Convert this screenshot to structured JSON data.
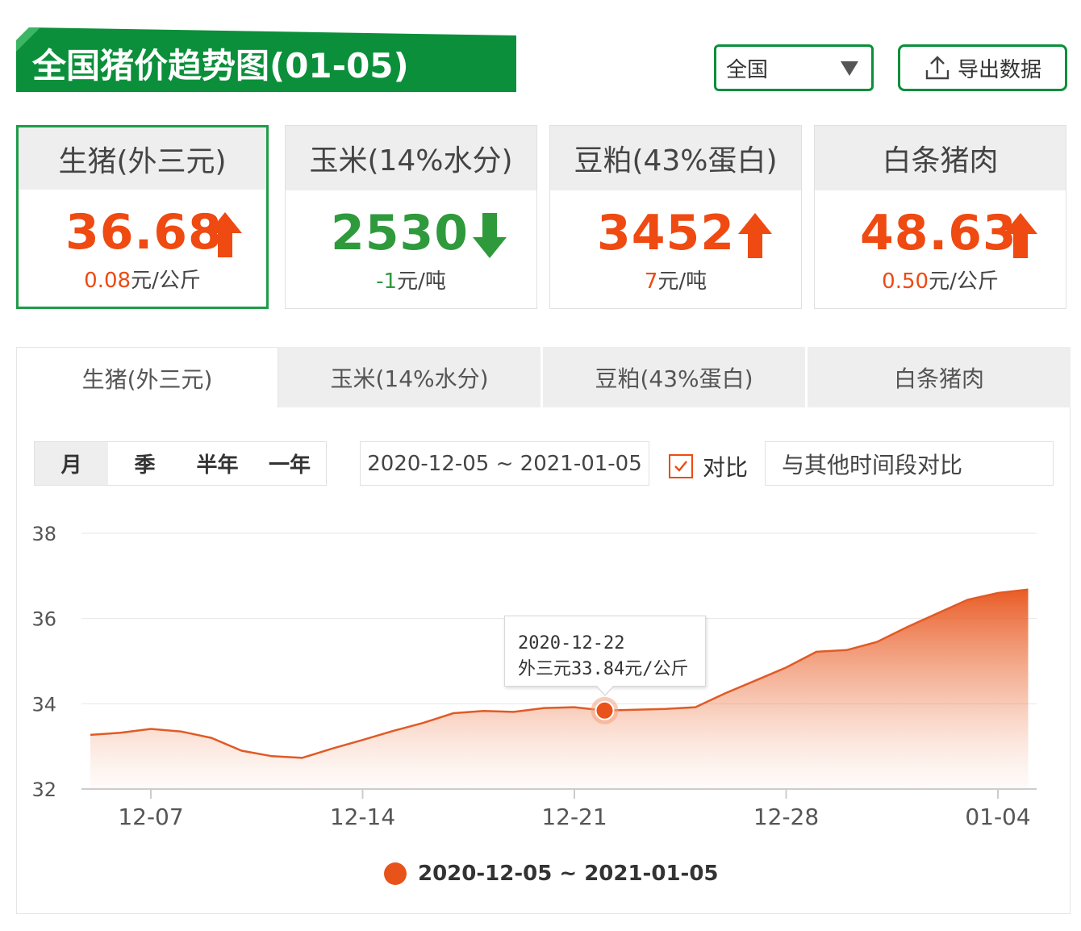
{
  "header": {
    "title": "全国猪价趋势图(01-05)",
    "region": "全国",
    "export_label": "导出数据"
  },
  "colors": {
    "brand_green": "#0b8f3a",
    "up_red": "#ee4a12",
    "down_green": "#2e9a3c",
    "series": "#e8531a"
  },
  "cards": [
    {
      "name": "生猪(外三元)",
      "price": "36.68",
      "direction": "up",
      "change_num": "0.08",
      "change_unit": "元/公斤"
    },
    {
      "name": "玉米(14%水分)",
      "price": "2530",
      "direction": "down",
      "change_num": "-1",
      "change_unit": "元/吨"
    },
    {
      "name": "豆粕(43%蛋白)",
      "price": "3452",
      "direction": "up",
      "change_num": "7",
      "change_unit": "元/吨"
    },
    {
      "name": "白条猪肉",
      "price": "48.63",
      "direction": "up",
      "change_num": "0.50",
      "change_unit": "元/公斤"
    }
  ],
  "tabs": [
    "生猪(外三元)",
    "玉米(14%水分)",
    "豆粕(43%蛋白)",
    "白条猪肉"
  ],
  "periods": [
    "月",
    "季",
    "半年",
    "一年"
  ],
  "date_range": "2020-12-05 ~ 2021-01-05",
  "compare_label": "对比",
  "compare_input": "与其他时间段对比",
  "tooltip": {
    "date": "2020-12-22",
    "text": "外三元33.84元/公斤"
  },
  "chart_data": {
    "type": "area",
    "title": "",
    "xlabel": "",
    "ylabel": "",
    "ylim": [
      32,
      38
    ],
    "yticks": [
      32,
      34,
      36,
      38
    ],
    "xticks": [
      "12-07",
      "12-14",
      "12-21",
      "12-28",
      "01-04"
    ],
    "grid": true,
    "legend": "bottom-center",
    "series": [
      {
        "name": "2020-12-05 ~ 2021-01-05",
        "x": [
          "12-05",
          "12-06",
          "12-07",
          "12-08",
          "12-09",
          "12-10",
          "12-11",
          "12-12",
          "12-13",
          "12-14",
          "12-15",
          "12-16",
          "12-17",
          "12-18",
          "12-19",
          "12-20",
          "12-21",
          "12-22",
          "12-23",
          "12-24",
          "12-25",
          "12-26",
          "12-27",
          "12-28",
          "12-29",
          "12-30",
          "12-31",
          "01-01",
          "01-02",
          "01-03",
          "01-04",
          "01-05"
        ],
        "values": [
          33.27,
          33.32,
          33.41,
          33.35,
          33.2,
          32.9,
          32.77,
          32.73,
          32.95,
          33.15,
          33.36,
          33.55,
          33.78,
          33.83,
          33.81,
          33.9,
          33.92,
          33.84,
          33.86,
          33.88,
          33.92,
          34.25,
          34.55,
          34.85,
          35.22,
          35.26,
          35.45,
          35.8,
          36.12,
          36.44,
          36.6,
          36.68
        ]
      }
    ]
  }
}
